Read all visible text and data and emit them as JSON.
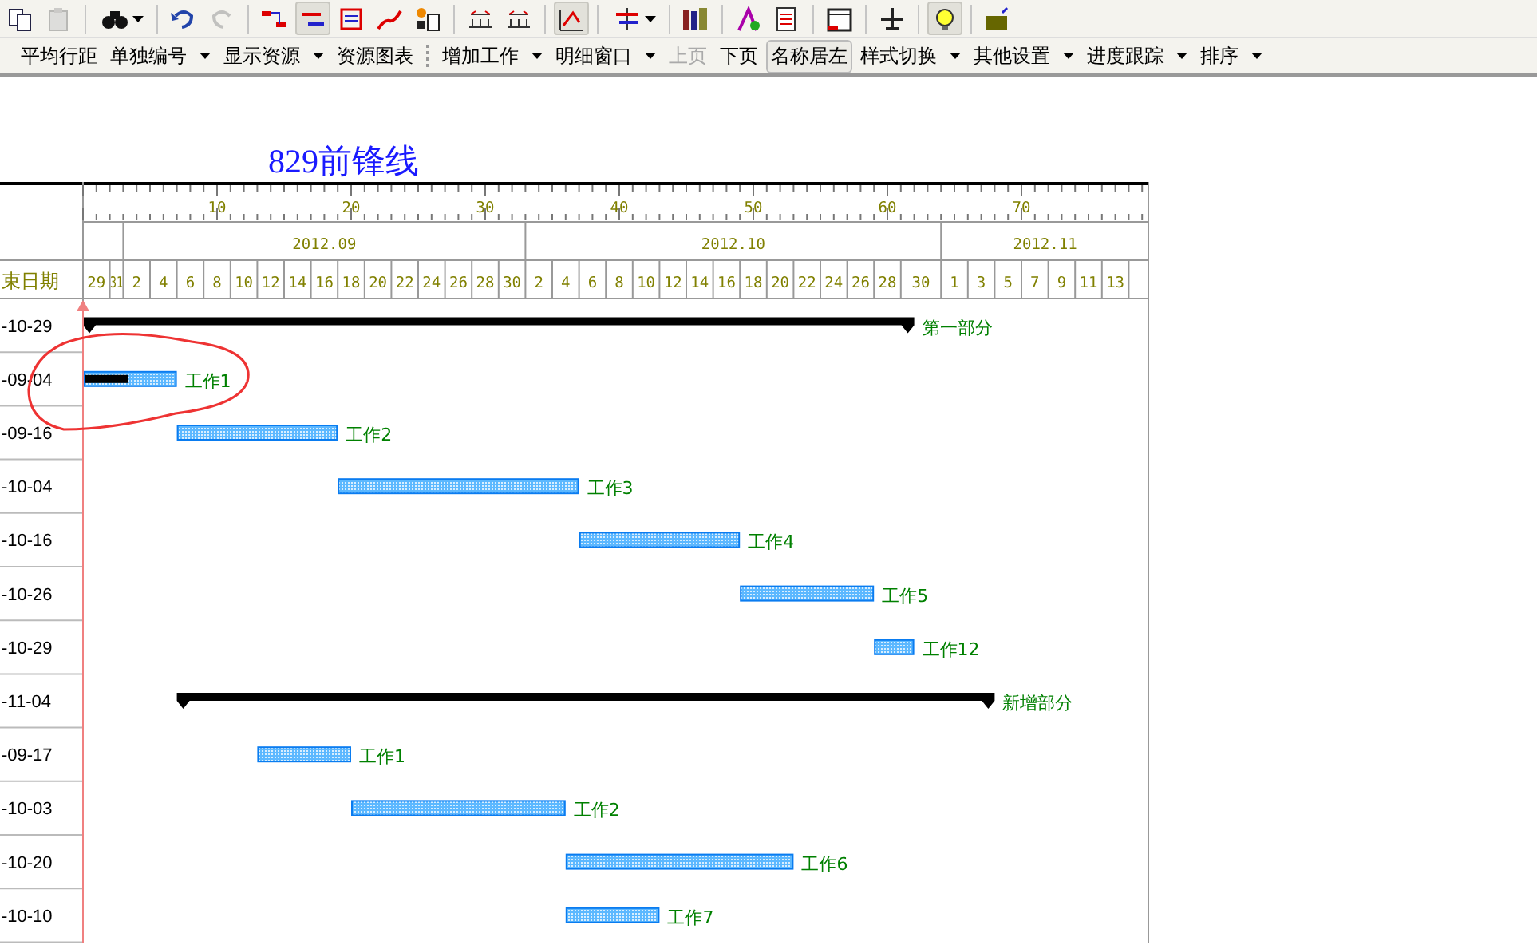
{
  "toolbar": {
    "buttons": [
      {
        "kind": "button",
        "pressed": false,
        "disabled": false
      },
      {
        "kind": "button",
        "pressed": false,
        "disabled": true
      },
      {
        "kind": "separator"
      },
      {
        "kind": "dropdown",
        "pressed": false,
        "disabled": false
      },
      {
        "kind": "separator"
      },
      {
        "kind": "button",
        "pressed": false,
        "disabled": false
      },
      {
        "kind": "button",
        "pressed": false,
        "disabled": true
      },
      {
        "kind": "separator"
      },
      {
        "kind": "button",
        "pressed": false,
        "disabled": false
      },
      {
        "kind": "button",
        "pressed": true,
        "disabled": false
      },
      {
        "kind": "button",
        "pressed": false,
        "disabled": false
      },
      {
        "kind": "button",
        "pressed": false,
        "disabled": false
      },
      {
        "kind": "button",
        "pressed": false,
        "disabled": false
      },
      {
        "kind": "separator"
      },
      {
        "kind": "button",
        "pressed": false,
        "disabled": false
      },
      {
        "kind": "button",
        "pressed": false,
        "disabled": false
      },
      {
        "kind": "separator"
      },
      {
        "kind": "button",
        "pressed": true,
        "disabled": false
      },
      {
        "kind": "separator"
      },
      {
        "kind": "dropdown",
        "pressed": false,
        "disabled": false
      },
      {
        "kind": "separator"
      },
      {
        "kind": "button",
        "pressed": false,
        "disabled": false
      },
      {
        "kind": "separator"
      },
      {
        "kind": "button",
        "pressed": false,
        "disabled": false
      },
      {
        "kind": "button",
        "pressed": false,
        "disabled": false
      },
      {
        "kind": "separator"
      },
      {
        "kind": "button",
        "pressed": false,
        "disabled": false
      },
      {
        "kind": "separator"
      },
      {
        "kind": "button",
        "pressed": false,
        "disabled": false
      },
      {
        "kind": "separator"
      },
      {
        "kind": "button",
        "pressed": true,
        "disabled": false
      },
      {
        "kind": "separator"
      },
      {
        "kind": "button",
        "pressed": false,
        "disabled": false
      }
    ]
  },
  "menu_bar": {
    "items": [
      {
        "kind": "button",
        "label": "平均行距",
        "disabled": false,
        "pressed": false
      },
      {
        "kind": "dropdown",
        "label": "单独编号",
        "disabled": false,
        "pressed": false
      },
      {
        "kind": "dropdown",
        "label": "显示资源",
        "disabled": false,
        "pressed": false
      },
      {
        "kind": "button",
        "label": "资源图表",
        "disabled": false,
        "pressed": false
      },
      {
        "kind": "grip"
      },
      {
        "kind": "dropdown",
        "label": "增加工作",
        "disabled": false,
        "pressed": false
      },
      {
        "kind": "dropdown",
        "label": "明细窗口",
        "disabled": false,
        "pressed": false
      },
      {
        "kind": "button",
        "label": "上页",
        "disabled": true,
        "pressed": false
      },
      {
        "kind": "button",
        "label": "下页",
        "disabled": false,
        "pressed": false
      },
      {
        "kind": "button",
        "label": "名称居左",
        "disabled": false,
        "pressed": true
      },
      {
        "kind": "dropdown",
        "label": "样式切换",
        "disabled": false,
        "pressed": false
      },
      {
        "kind": "dropdown",
        "label": "其他设置",
        "disabled": false,
        "pressed": false
      },
      {
        "kind": "dropdown",
        "label": "进度跟踪",
        "disabled": false,
        "pressed": false
      },
      {
        "kind": "dropdown",
        "label": "排序",
        "disabled": false,
        "pressed": false
      }
    ]
  },
  "chart_title": "829前锋线",
  "gantt": {
    "column_header": "束日期",
    "ruler_labels": [
      "10",
      "20",
      "30",
      "40",
      "50",
      "60",
      "70"
    ],
    "months": [
      "2012.09",
      "2012.10",
      "2012.11"
    ],
    "days": [
      "29",
      "31",
      "2",
      "4",
      "6",
      "8",
      "10",
      "12",
      "14",
      "16",
      "18",
      "20",
      "22",
      "24",
      "26",
      "28",
      "30",
      "2",
      "4",
      "6",
      "8",
      "10",
      "12",
      "14",
      "16",
      "18",
      "20",
      "22",
      "24",
      "26",
      "28",
      "30",
      "1",
      "3",
      "5",
      "7",
      "9",
      "11",
      "13"
    ],
    "rows": [
      {
        "kind": "summary",
        "name": "第一部分",
        "end_date": "-10-29"
      },
      {
        "kind": "task",
        "name": "工作1",
        "end_date": "-09-04",
        "level": 0.48
      },
      {
        "kind": "task",
        "name": "工作2",
        "end_date": "-09-16"
      },
      {
        "kind": "task",
        "name": "工作3",
        "end_date": "-10-04"
      },
      {
        "kind": "task",
        "name": "工作4",
        "end_date": "-10-16"
      },
      {
        "kind": "task",
        "name": "工作5",
        "end_date": "-10-26"
      },
      {
        "kind": "task",
        "name": "工作12",
        "end_date": "-10-29"
      },
      {
        "kind": "summary",
        "name": "新增部分",
        "end_date": "-11-04"
      },
      {
        "kind": "task",
        "name": "工作1",
        "end_date": "-09-17"
      },
      {
        "kind": "task",
        "name": "工作2",
        "end_date": "-10-03"
      },
      {
        "kind": "task",
        "name": "工作6",
        "end_date": "-10-20"
      },
      {
        "kind": "task",
        "name": "工作7",
        "end_date": "-10-10"
      }
    ]
  }
}
